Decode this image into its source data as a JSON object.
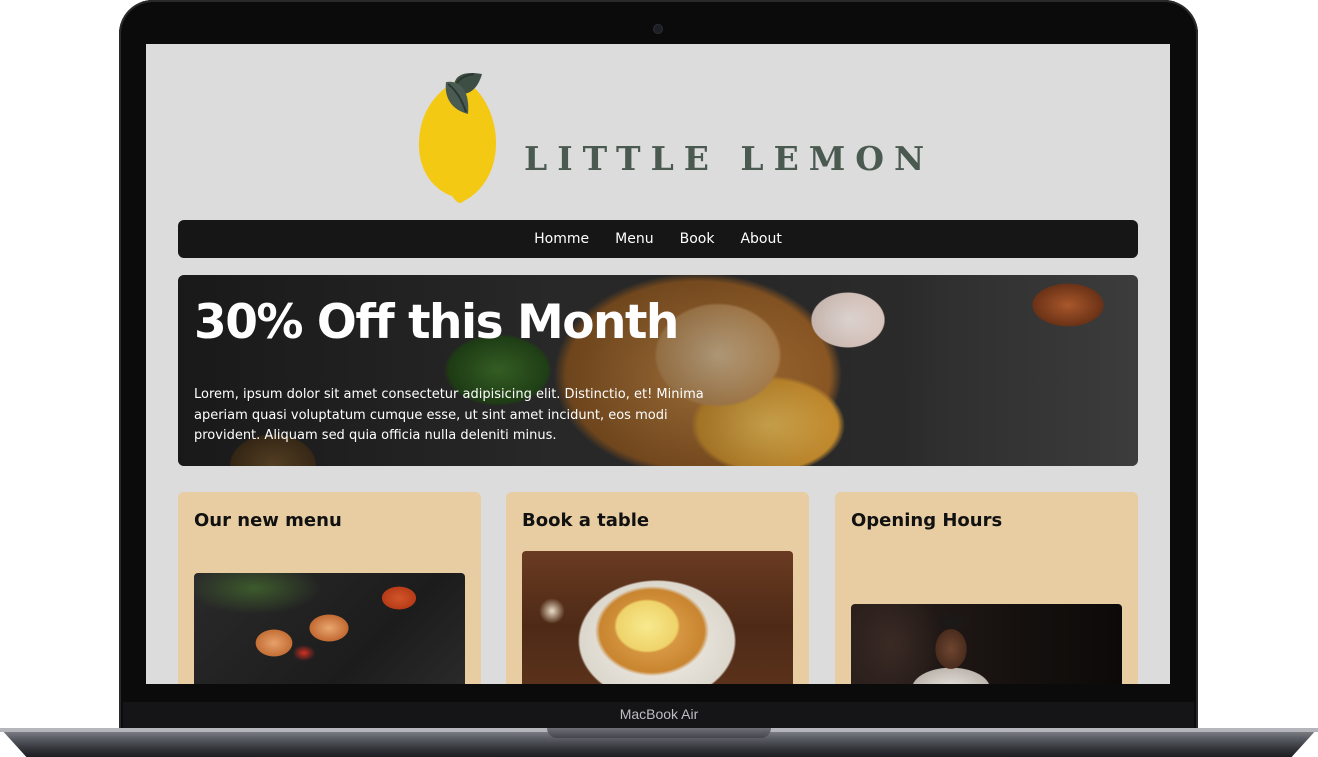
{
  "device": {
    "label": "MacBook Air"
  },
  "site": {
    "logo_text": "LITTLE LEMON",
    "colors": {
      "brand_text": "#4a5a50",
      "lemon": "#f4c914",
      "leaf": "#3d4e45",
      "nav_bg": "#161616",
      "card_bg": "#e7cda1",
      "page_bg": "#dcdcdc"
    }
  },
  "nav": {
    "items": [
      {
        "label": "Homme"
      },
      {
        "label": "Menu"
      },
      {
        "label": "Book"
      },
      {
        "label": "About"
      }
    ]
  },
  "hero": {
    "title": "30% Off this Month",
    "body": "Lorem, ipsum dolor sit amet consectetur adipisicing elit. Distinctio, et! Minima aperiam quasi voluptatum cumque esse, ut sint amet incidunt, eos modi provident. Aliquam sed quia officia nulla deleniti minus."
  },
  "cards": [
    {
      "title": "Our new menu",
      "image": "kebab-skewers-photo"
    },
    {
      "title": "Book a table",
      "image": "nachos-photo"
    },
    {
      "title": "Opening Hours",
      "image": "chef-photo"
    }
  ]
}
